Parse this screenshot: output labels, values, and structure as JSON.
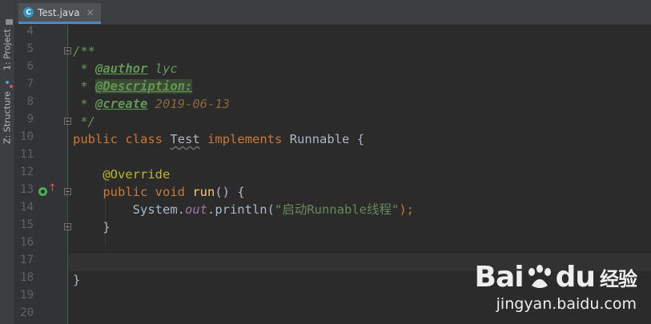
{
  "side_panel": {
    "project_tab": "1: Project",
    "structure_tab": "Z: Structure"
  },
  "editor_tabs": [
    {
      "icon_letter": "C",
      "label": "Test.java"
    }
  ],
  "line_numbers": [
    "4",
    "5",
    "6",
    "7",
    "8",
    "9",
    "10",
    "11",
    "12",
    "13",
    "14",
    "15",
    "16",
    "17",
    "18",
    "19",
    "20"
  ],
  "code": {
    "l5": "/**",
    "l6_star": " * ",
    "l6_tag": "@author",
    "l6_val": " lyc",
    "l7_star": " * ",
    "l7_tag": "@Description:",
    "l8_star": " * ",
    "l8_tag": "@create",
    "l8_val": " 2019-06-13",
    "l9": " */",
    "l10_public": "public",
    "l10_class": "class",
    "l10_name": "Test",
    "l10_impl": "implements",
    "l10_iface": "Runnable {",
    "l12": "@Override",
    "l13_public": "public",
    "l13_void": "void",
    "l13_run": "run",
    "l13_rest": "() {",
    "l14_sys": "System.",
    "l14_out": "out",
    "l14_println": ".println(",
    "l14_str": "\"启动Runnable线程\"",
    "l14_end": ");",
    "l15": "}",
    "l18": "}"
  },
  "watermark": {
    "brand_left": "Bai",
    "brand_right": "du",
    "brand_cn": "经验",
    "site": "jingyan.baidu.com"
  },
  "colors": {
    "keyword": "#cc7832",
    "javadoc": "#629755",
    "annotation": "#bbb529",
    "method": "#ffc66d",
    "string": "#6a8759",
    "field": "#9876aa"
  }
}
